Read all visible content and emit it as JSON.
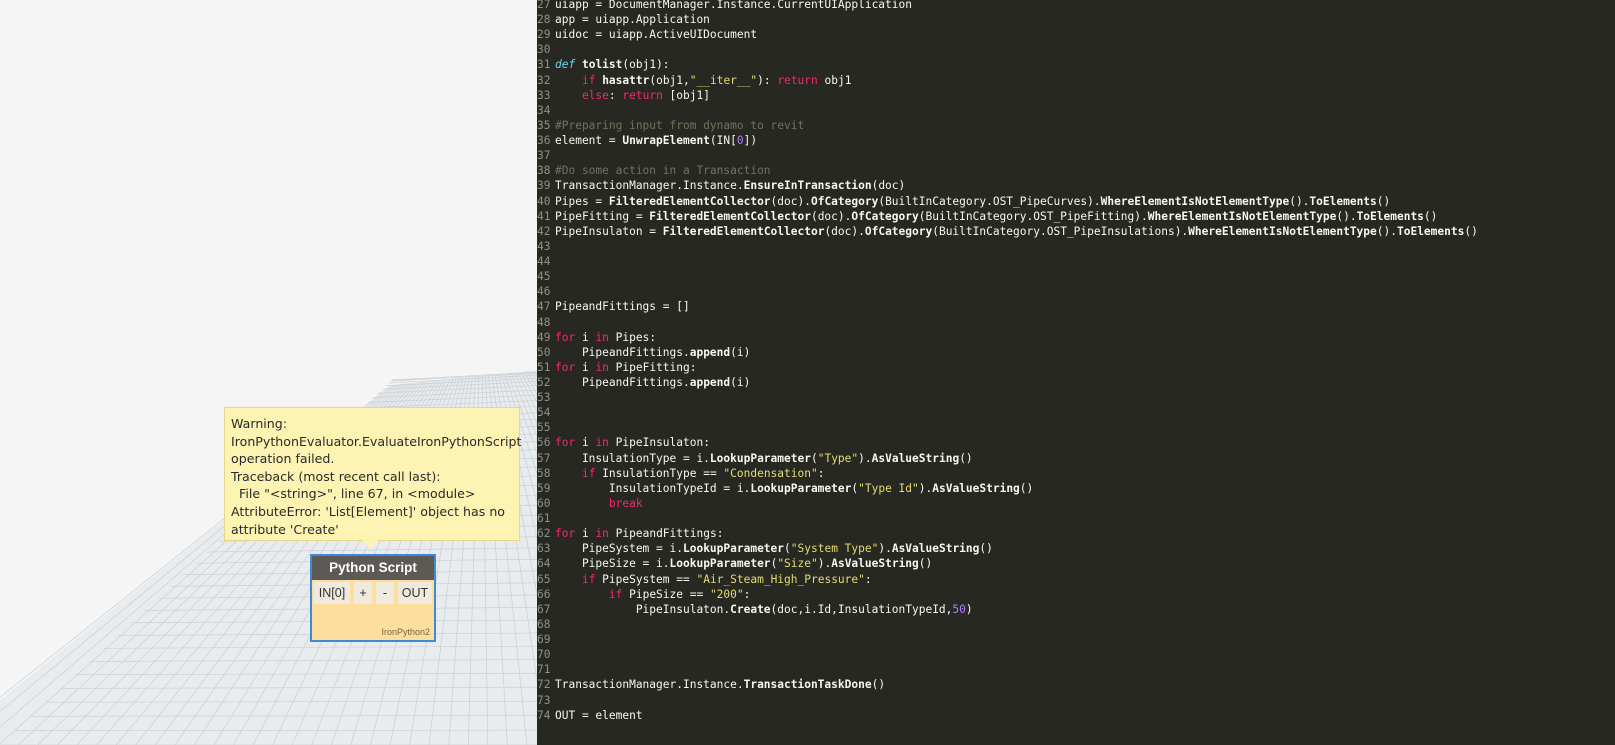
{
  "warning": {
    "lines": [
      "Warning:",
      "IronPythonEvaluator.EvaluateIronPythonScript",
      "operation failed.",
      "Traceback (most recent call last):",
      "  File \"<string>\", line 67, in <module>",
      "AttributeError: 'List[Element]' object has no",
      "attribute 'Create'"
    ]
  },
  "node": {
    "title": "Python Script",
    "in_port": "IN[0]",
    "add_label": "+",
    "remove_label": "-",
    "out_port": "OUT",
    "engine": "IronPython2"
  },
  "editor": {
    "lines": [
      {
        "n": "27",
        "t": "uiapp = DocumentManager.Instance.CurrentUIApplication"
      },
      {
        "n": "28",
        "t": "app = uiapp.Application"
      },
      {
        "n": "29",
        "t": "uidoc = uiapp.ActiveUIDocument"
      },
      {
        "n": "30",
        "t": ""
      },
      {
        "n": "31",
        "t": "def tolist(obj1):"
      },
      {
        "n": "32",
        "t": "    if hasattr(obj1,\"__iter__\"): return obj1"
      },
      {
        "n": "33",
        "t": "    else: return [obj1]"
      },
      {
        "n": "34",
        "t": ""
      },
      {
        "n": "35",
        "t": "#Preparing input from dynamo to revit"
      },
      {
        "n": "36",
        "t": "element = UnwrapElement(IN[0])"
      },
      {
        "n": "37",
        "t": ""
      },
      {
        "n": "38",
        "t": "#Do some action in a Transaction"
      },
      {
        "n": "39",
        "t": "TransactionManager.Instance.EnsureInTransaction(doc)"
      },
      {
        "n": "40",
        "t": "Pipes = FilteredElementCollector(doc).OfCategory(BuiltInCategory.OST_PipeCurves).WhereElementIsNotElementType().ToElements()"
      },
      {
        "n": "41",
        "t": "PipeFitting = FilteredElementCollector(doc).OfCategory(BuiltInCategory.OST_PipeFitting).WhereElementIsNotElementType().ToElements()"
      },
      {
        "n": "42",
        "t": "PipeInsulaton = FilteredElementCollector(doc).OfCategory(BuiltInCategory.OST_PipeInsulations).WhereElementIsNotElementType().ToElements()"
      },
      {
        "n": "43",
        "t": ""
      },
      {
        "n": "44",
        "t": ""
      },
      {
        "n": "45",
        "t": ""
      },
      {
        "n": "46",
        "t": ""
      },
      {
        "n": "47",
        "t": "PipeandFittings = []"
      },
      {
        "n": "48",
        "t": ""
      },
      {
        "n": "49",
        "t": "for i in Pipes:"
      },
      {
        "n": "50",
        "t": "    PipeandFittings.append(i)"
      },
      {
        "n": "51",
        "t": "for i in PipeFitting:"
      },
      {
        "n": "52",
        "t": "    PipeandFittings.append(i)"
      },
      {
        "n": "53",
        "t": ""
      },
      {
        "n": "54",
        "t": ""
      },
      {
        "n": "55",
        "t": ""
      },
      {
        "n": "56",
        "t": "for i in PipeInsulaton:"
      },
      {
        "n": "57",
        "t": "    InsulationType = i.LookupParameter(\"Type\").AsValueString()"
      },
      {
        "n": "58",
        "t": "    if InsulationType == \"Condensation\":"
      },
      {
        "n": "59",
        "t": "        InsulationTypeId = i.LookupParameter(\"Type Id\").AsValueString()"
      },
      {
        "n": "60",
        "t": "        break"
      },
      {
        "n": "61",
        "t": ""
      },
      {
        "n": "62",
        "t": "for i in PipeandFittings:"
      },
      {
        "n": "63",
        "t": "    PipeSystem = i.LookupParameter(\"System Type\").AsValueString()"
      },
      {
        "n": "64",
        "t": "    PipeSize = i.LookupParameter(\"Size\").AsValueString()"
      },
      {
        "n": "65",
        "t": "    if PipeSystem == \"Air_Steam_High_Pressure\":"
      },
      {
        "n": "66",
        "t": "        if PipeSize == \"200\":"
      },
      {
        "n": "67",
        "t": "            PipeInsulaton.Create(doc,i.Id,InsulationTypeId,50)"
      },
      {
        "n": "68",
        "t": ""
      },
      {
        "n": "69",
        "t": ""
      },
      {
        "n": "70",
        "t": ""
      },
      {
        "n": "71",
        "t": ""
      },
      {
        "n": "72",
        "t": "TransactionManager.Instance.TransactionTaskDone()"
      },
      {
        "n": "73",
        "t": ""
      },
      {
        "n": "74",
        "t": "OUT = element"
      }
    ]
  },
  "colors": {
    "editor_bg": "#272822",
    "keyword": "#f92672",
    "def_keyword": "#66d9ef",
    "string": "#e6db74",
    "number": "#ae81ff",
    "comment": "#75715e",
    "node_header": "#5d5a56",
    "node_body": "#fcdf9c",
    "node_border": "#3f8ad8",
    "warning_bg": "#fdf3b3"
  }
}
